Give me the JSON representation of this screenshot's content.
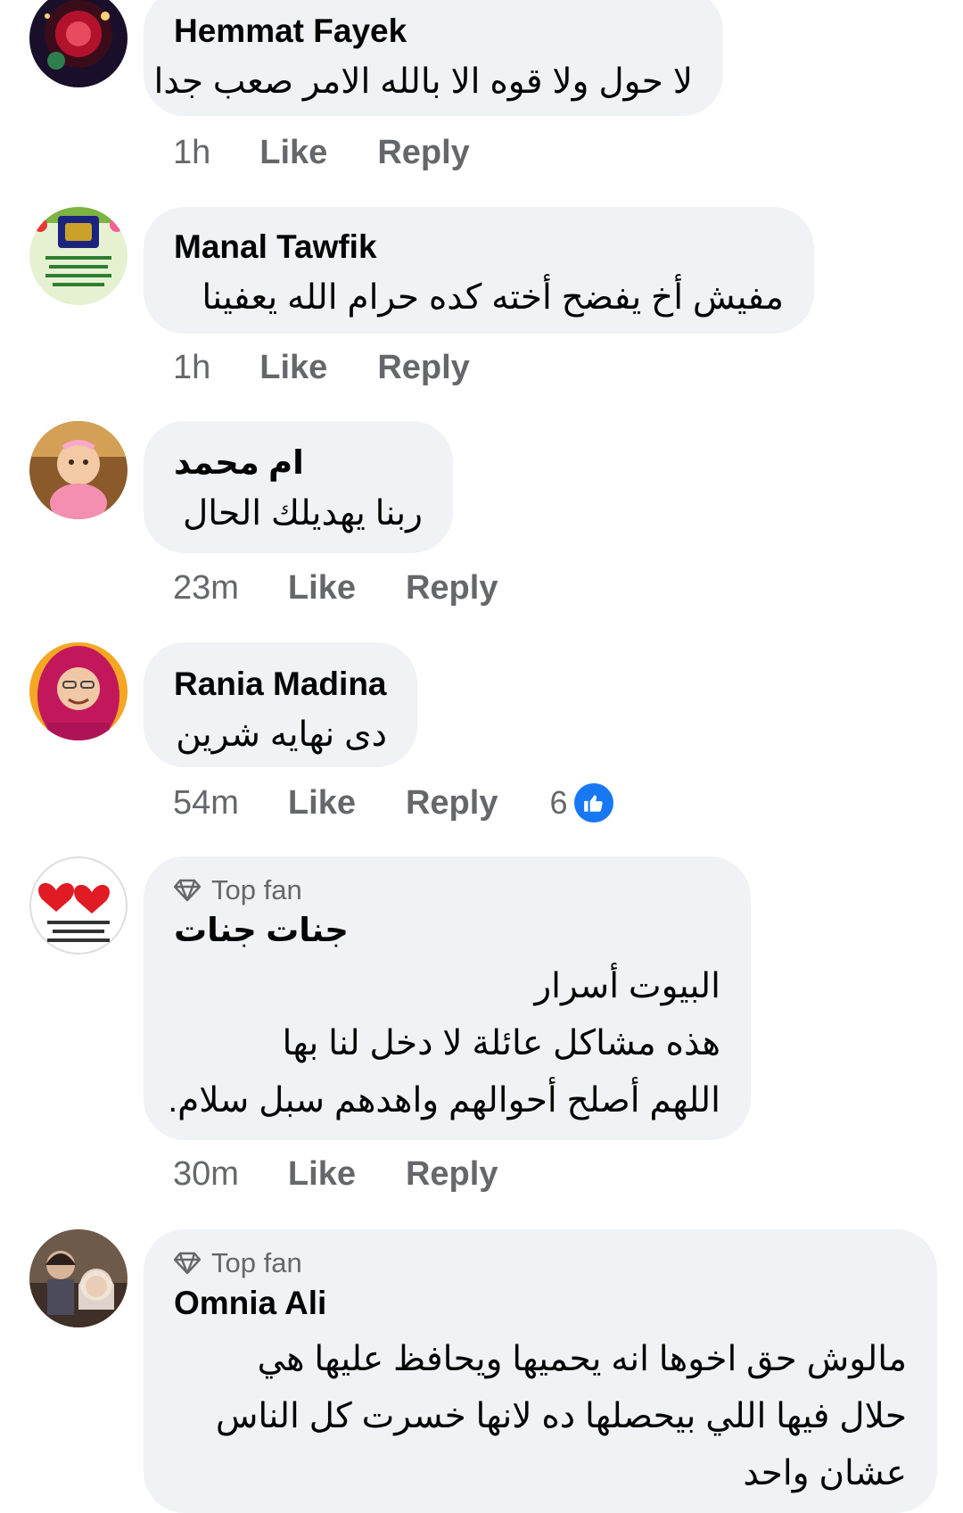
{
  "comments": [
    {
      "name": "Hemmat Fayek",
      "lines": [
        "لا حول ولا قوه الا بالله الامر صعب جدا"
      ],
      "time": "1h",
      "like_label": "Like",
      "reply_label": "Reply",
      "avatar_icon": "avatar-dark-red-image"
    },
    {
      "name": "Manal Tawfik",
      "lines": [
        "مفيش أخ يفضح أخته كده حرام  الله يعفينا"
      ],
      "time": "1h",
      "like_label": "Like",
      "reply_label": "Reply",
      "avatar_icon": "avatar-quran-image"
    },
    {
      "name": "ام محمد",
      "lines": [
        "ربنا يهديلك الحال"
      ],
      "time": "23m",
      "like_label": "Like",
      "reply_label": "Reply",
      "avatar_icon": "avatar-baby-image"
    },
    {
      "name": "Rania Madina",
      "lines": [
        "دى نهايه شرين"
      ],
      "time": "54m",
      "like_label": "Like",
      "reply_label": "Reply",
      "reaction_count": "6",
      "reaction_icon": "like-reaction-icon",
      "avatar_icon": "avatar-woman-pink-hijab-image"
    },
    {
      "badge": "Top fan",
      "name": "جنات جنات",
      "lines": [
        "البيوت أسرار",
        "هذه مشاكل عائلة لا دخل لنا بها",
        "اللهم أصلح أحوالهم واهدهم سبل سلام."
      ],
      "time": "30m",
      "like_label": "Like",
      "reply_label": "Reply",
      "avatar_icon": "avatar-red-hearts-image"
    },
    {
      "badge": "Top fan",
      "name": "Omnia Ali",
      "lines": [
        "مالوش حق اخوها انه يحميها ويحافظ عليها هي",
        "حلال فيها اللي بيحصلها ده لانها خسرت كل الناس",
        "عشان واحد"
      ],
      "avatar_icon": "avatar-women-photo-image"
    }
  ],
  "colors": {
    "bubble_bg": "#f0f2f5",
    "text": "#050505",
    "secondary": "#65676b",
    "like_blue": "#1877f2"
  }
}
